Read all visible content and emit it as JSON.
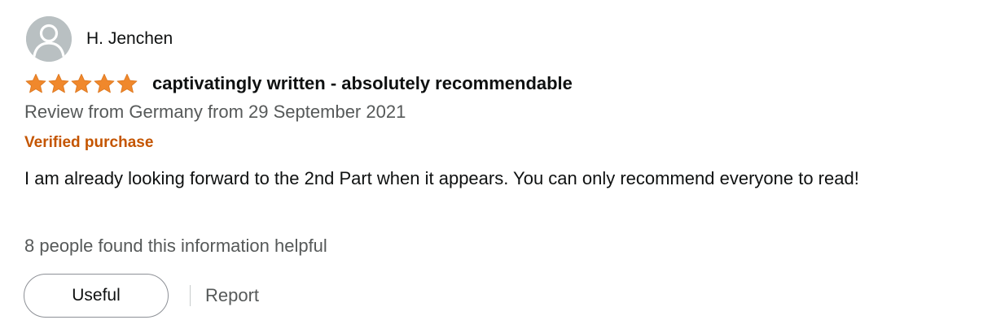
{
  "review": {
    "reviewer_name": "H. Jenchen",
    "rating": 5,
    "rating_max": 5,
    "title": "captivatingly written - absolutely recommendable",
    "meta": "Review from Germany from 29 September 2021",
    "verified_label": "Verified purchase",
    "body": "I am already looking forward to the 2nd Part when it appears. You can only recommend everyone to read!",
    "helpful_text": "8 people found this information helpful"
  },
  "actions": {
    "useful_label": "Useful",
    "report_label": "Report"
  },
  "icons": {
    "avatar": "user-avatar-icon",
    "star": "star-icon"
  },
  "colors": {
    "star": "#f0882c",
    "verified": "#c45500",
    "secondary_text": "#565959",
    "primary_text": "#0f1111",
    "avatar_bg": "#b9c0c2"
  }
}
